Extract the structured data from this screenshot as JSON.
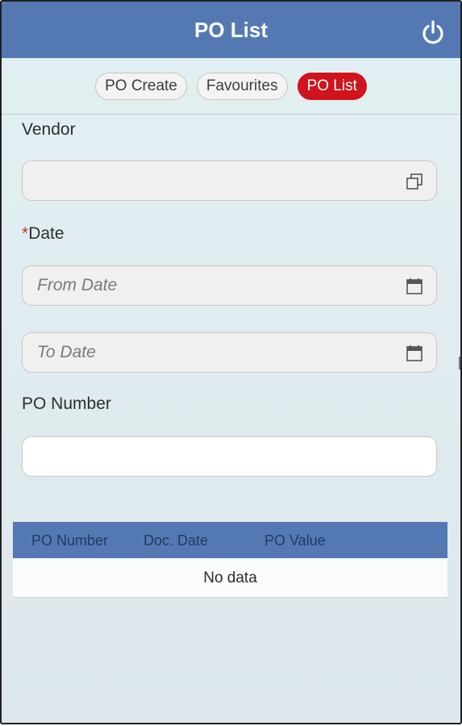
{
  "header": {
    "title": "PO List",
    "power_icon": "power-icon"
  },
  "tabs": [
    {
      "label": "PO Create",
      "active": false
    },
    {
      "label": "Favourites",
      "active": false
    },
    {
      "label": "PO List",
      "active": true
    }
  ],
  "form": {
    "vendor": {
      "label": "Vendor",
      "value": "",
      "icon": "value-help-icon"
    },
    "date": {
      "required_mark": "*",
      "label": "Date",
      "from_placeholder": "From Date",
      "to_placeholder": "To Date",
      "icon": "calendar-icon"
    },
    "po_number": {
      "label": "PO Number",
      "value": ""
    }
  },
  "table": {
    "columns": [
      "PO Number",
      "Doc. Date",
      "PO Value"
    ],
    "empty_text": "No data"
  },
  "colors": {
    "header": "#5479b2",
    "active_tab": "#d0141d",
    "background": "#e3f0f2"
  }
}
